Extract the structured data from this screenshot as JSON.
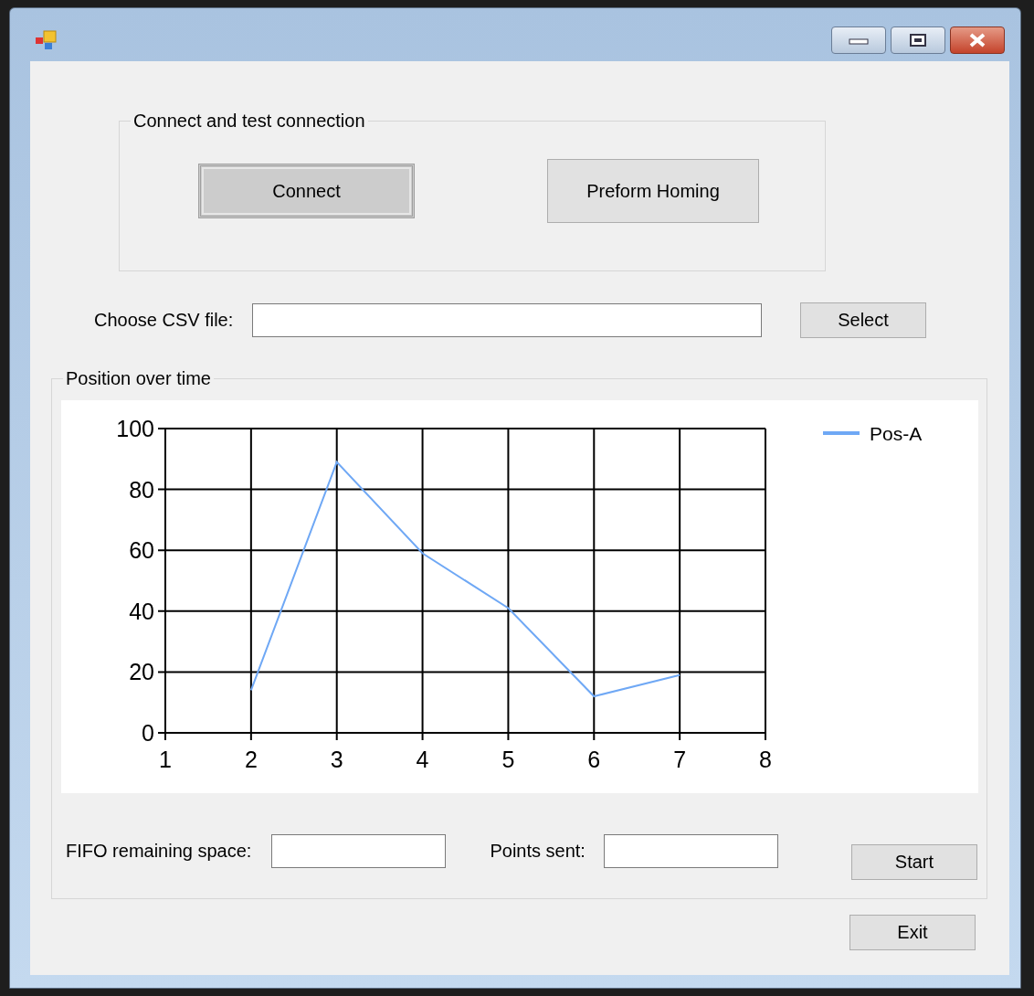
{
  "connection_group": {
    "title": "Connect and test connection",
    "buttons": [
      {
        "label": "Connect",
        "focused": true
      },
      {
        "label": "Preform Homing",
        "focused": false
      }
    ]
  },
  "csv_file": {
    "label": "Choose CSV file:",
    "button": "Select"
  },
  "chart_group": {
    "title": "Position over time",
    "chart_data": {
      "type": "line",
      "x": [
        2,
        3,
        4,
        5,
        6,
        7
      ],
      "series": [
        {
          "name": "Pos-A",
          "color": "#6fa8f5",
          "values": [
            14,
            89,
            59,
            41,
            12,
            19
          ]
        }
      ],
      "xlim": [
        1,
        8
      ],
      "ylim": [
        0,
        100
      ],
      "xticks": [
        1,
        2,
        3,
        4,
        5,
        6,
        7,
        8
      ],
      "yticks": [
        0,
        20,
        40,
        60,
        80,
        100
      ],
      "grid": true
    },
    "fifo_label": "FIFO remaining space:",
    "points_sent_label": "Points sent:",
    "start_button": "Start"
  },
  "exit_button": "Exit"
}
